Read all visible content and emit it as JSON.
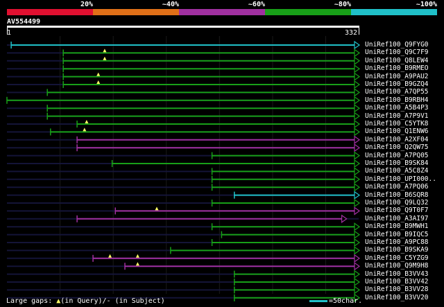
{
  "legend": {
    "labels": [
      "20%",
      "~40%",
      "~60%",
      "~80%",
      "~100%"
    ],
    "colors": [
      "#e01030",
      "#e07018",
      "#a030a0",
      "#18a018",
      "#20c0c8"
    ]
  },
  "query": {
    "id": "AV554499",
    "start": "1",
    "end": "332",
    "length": 332
  },
  "hits": [
    {
      "label": "UniRef100_Q9FYG0",
      "start": 5,
      "end": 332,
      "color": "#20c0c8",
      "gaps": []
    },
    {
      "label": "UniRef100_Q9C7F9",
      "start": 54,
      "end": 332,
      "color": "#18a018",
      "gaps": [
        {
          "q": 93
        }
      ]
    },
    {
      "label": "UniRef100_Q8LEW4",
      "start": 54,
      "end": 332,
      "color": "#18a018",
      "gaps": [
        {
          "q": 93
        }
      ]
    },
    {
      "label": "UniRef100_B9RMEO",
      "start": 54,
      "end": 332,
      "color": "#18a018",
      "gaps": []
    },
    {
      "label": "UniRef100_A9PAU2",
      "start": 54,
      "end": 332,
      "color": "#18a018",
      "gaps": [
        {
          "q": 87
        }
      ]
    },
    {
      "label": "UniRef100_B9GZQ4",
      "start": 54,
      "end": 332,
      "color": "#18a018",
      "gaps": [
        {
          "q": 87
        }
      ]
    },
    {
      "label": "UniRef100_A7QP55",
      "start": 39,
      "end": 332,
      "color": "#18a018",
      "gaps": []
    },
    {
      "label": "UniRef100_B9RBH4",
      "start": 1,
      "end": 332,
      "color": "#18a018",
      "gaps": []
    },
    {
      "label": "UniRef100_A5B4P3",
      "start": 39,
      "end": 332,
      "color": "#18a018",
      "gaps": []
    },
    {
      "label": "UniRef100_A7P9V1",
      "start": 39,
      "end": 332,
      "color": "#18a018",
      "gaps": []
    },
    {
      "label": "UniRef100_C5YTK8",
      "start": 67,
      "end": 332,
      "color": "#18a018",
      "gaps": [
        {
          "q": 76
        }
      ]
    },
    {
      "label": "UniRef100_Q1ENW6",
      "start": 42,
      "end": 332,
      "color": "#18a018",
      "gaps": [
        {
          "q": 74
        }
      ]
    },
    {
      "label": "UniRef100_A2XF04",
      "start": 67,
      "end": 332,
      "color": "#a030a0",
      "gaps": []
    },
    {
      "label": "UniRef100_Q2QW75",
      "start": 67,
      "end": 332,
      "color": "#a030a0",
      "gaps": []
    },
    {
      "label": "UniRef100_A7PQ05",
      "start": 194,
      "end": 332,
      "color": "#18a018",
      "gaps": []
    },
    {
      "label": "UniRef100_B9SK84",
      "start": 100,
      "end": 332,
      "color": "#18a018",
      "gaps": []
    },
    {
      "label": "UniRef100_A5C8Z4",
      "start": 194,
      "end": 332,
      "color": "#18a018",
      "gaps": []
    },
    {
      "label": "UniRef100_UPI000..",
      "start": 194,
      "end": 332,
      "color": "#18a018",
      "gaps": []
    },
    {
      "label": "UniRef100_A7PQ06",
      "start": 194,
      "end": 332,
      "color": "#18a018",
      "gaps": []
    },
    {
      "label": "UniRef100_B6SQR8",
      "start": 215,
      "end": 332,
      "color": "#20c0c8",
      "gaps": []
    },
    {
      "label": "UniRef100_Q9LQ32",
      "start": 194,
      "end": 332,
      "color": "#18a018",
      "gaps": []
    },
    {
      "label": "UniRef100_Q9T0F7",
      "start": 103,
      "end": 332,
      "color": "#a030a0",
      "gaps": [
        {
          "q": 142
        }
      ]
    },
    {
      "label": "UniRef100_A3AI97",
      "start": 67,
      "end": 320,
      "color": "#a030a0",
      "gaps": []
    },
    {
      "label": "UniRef100_B9MWH1",
      "start": 194,
      "end": 332,
      "color": "#18a018",
      "gaps": []
    },
    {
      "label": "UniRef100_B9IQC5",
      "start": 203,
      "end": 332,
      "color": "#18a018",
      "gaps": []
    },
    {
      "label": "UniRef100_A9PC88",
      "start": 194,
      "end": 332,
      "color": "#18a018",
      "gaps": []
    },
    {
      "label": "UniRef100_B9SKA9",
      "start": 155,
      "end": 332,
      "color": "#18a018",
      "gaps": []
    },
    {
      "label": "UniRef100_C5YZG9",
      "start": 82,
      "end": 332,
      "color": "#a030a0",
      "gaps": [
        {
          "q": 98
        },
        {
          "q": 124
        }
      ]
    },
    {
      "label": "UniRef100_Q9M9H8",
      "start": 112,
      "end": 332,
      "color": "#a030a0",
      "gaps": [
        {
          "q": 124
        }
      ]
    },
    {
      "label": "UniRef100_B3VV43",
      "start": 215,
      "end": 332,
      "color": "#18a018",
      "gaps": []
    },
    {
      "label": "UniRef100_B3VV42",
      "start": 215,
      "end": 332,
      "color": "#18a018",
      "gaps": []
    },
    {
      "label": "UniRef100_B3VV28",
      "start": 215,
      "end": 332,
      "color": "#18a018",
      "gaps": []
    },
    {
      "label": "UniRef100_B3VV20",
      "start": 215,
      "end": 332,
      "color": "#18a018",
      "gaps": []
    }
  ],
  "footer": {
    "gaps_prefix": "Large gaps: ",
    "gap_marker": "▲",
    "gaps_suffix": "(in Query)/- (in Subject)",
    "scale_text": "=50char."
  }
}
